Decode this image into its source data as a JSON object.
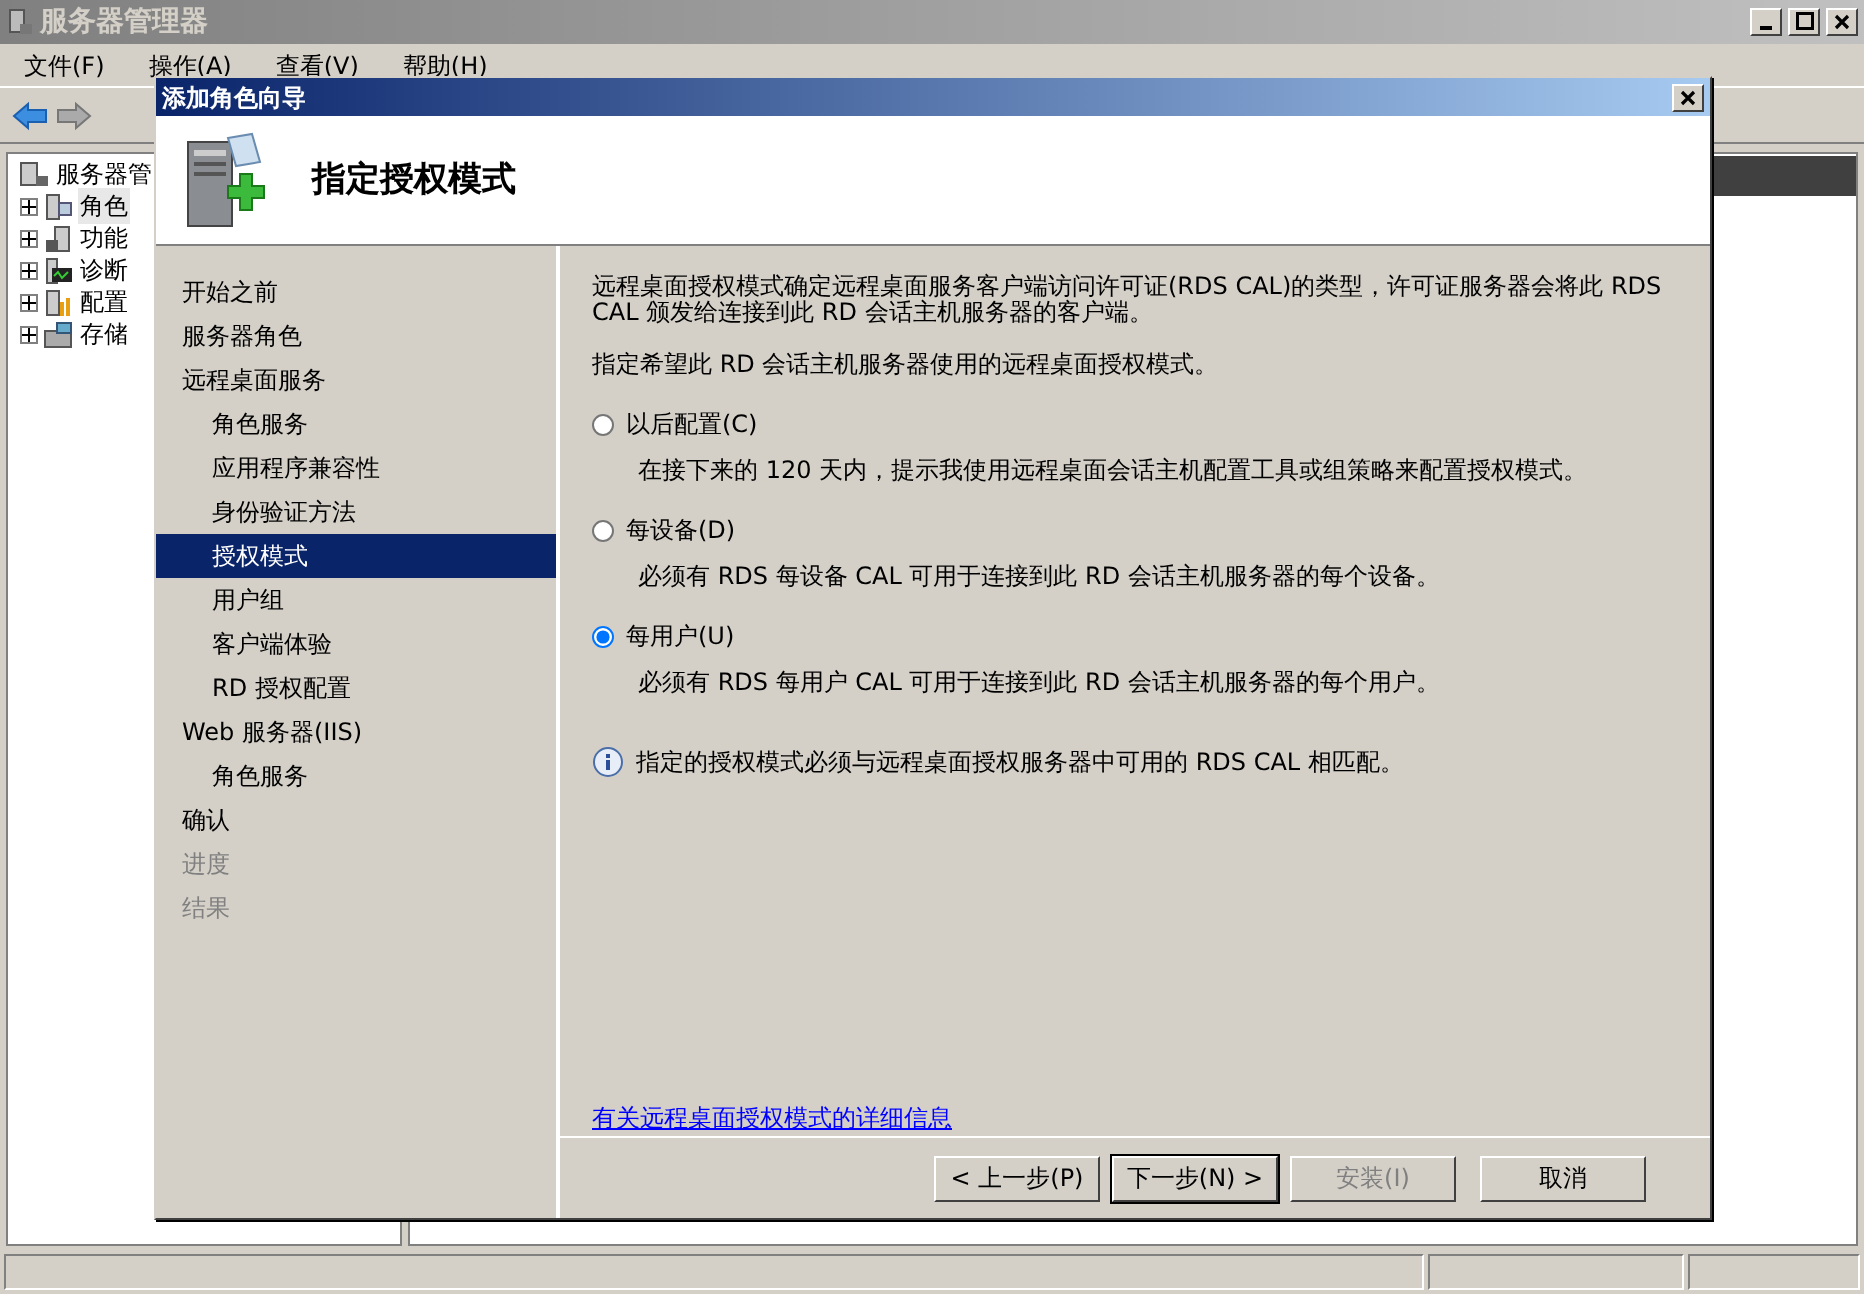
{
  "app": {
    "title": "服务器管理器",
    "menu": [
      "文件(F)",
      "操作(A)",
      "查看(V)",
      "帮助(H)"
    ],
    "tree": [
      {
        "label": "服务器管",
        "expanded": true,
        "children": [
          {
            "label": "角色",
            "selected": true,
            "expanded": false
          },
          {
            "label": "功能",
            "selected": false,
            "expanded": false
          },
          {
            "label": "诊断",
            "selected": false,
            "expanded": false
          },
          {
            "label": "配置",
            "selected": false,
            "expanded": false
          },
          {
            "label": "存储",
            "selected": false,
            "expanded": false
          }
        ]
      }
    ]
  },
  "dialog": {
    "title": "添加角色向导",
    "heading": "指定授权模式",
    "steps": [
      {
        "label": "开始之前",
        "selected": false,
        "disabled": false
      },
      {
        "label": "服务器角色",
        "selected": false,
        "disabled": false
      },
      {
        "label": "远程桌面服务",
        "selected": false,
        "disabled": false,
        "children": [
          {
            "label": "角色服务",
            "selected": false,
            "disabled": false
          },
          {
            "label": "应用程序兼容性",
            "selected": false,
            "disabled": false
          },
          {
            "label": "身份验证方法",
            "selected": false,
            "disabled": false
          },
          {
            "label": "授权模式",
            "selected": true,
            "disabled": false
          },
          {
            "label": "用户组",
            "selected": false,
            "disabled": false
          },
          {
            "label": "客户端体验",
            "selected": false,
            "disabled": false
          },
          {
            "label": "RD 授权配置",
            "selected": false,
            "disabled": false
          }
        ]
      },
      {
        "label": "Web 服务器(IIS)",
        "selected": false,
        "disabled": false,
        "children": [
          {
            "label": "角色服务",
            "selected": false,
            "disabled": false
          }
        ]
      },
      {
        "label": "确认",
        "selected": false,
        "disabled": false
      },
      {
        "label": "进度",
        "selected": false,
        "disabled": true
      },
      {
        "label": "结果",
        "selected": false,
        "disabled": true
      }
    ],
    "intro": "远程桌面授权模式确定远程桌面服务客户端访问许可证(RDS CAL)的类型，许可证服务器会将此 RDS CAL 颁发给连接到此 RD 会话主机服务器的客户端。",
    "prompt": "指定希望此 RD 会话主机服务器使用的远程桌面授权模式。",
    "options": [
      {
        "label": "以后配置(C)",
        "description": "在接下来的 120 天内，提示我使用远程桌面会话主机配置工具或组策略来配置授权模式。",
        "selected": false
      },
      {
        "label": "每设备(D)",
        "description": "必须有 RDS 每设备 CAL 可用于连接到此 RD 会话主机服务器的每个设备。",
        "selected": false
      },
      {
        "label": "每用户(U)",
        "description": "必须有 RDS 每用户 CAL 可用于连接到此 RD 会话主机服务器的每个用户。",
        "selected": true
      }
    ],
    "note": "指定的授权模式必须与远程桌面授权服务器中可用的 RDS CAL 相匹配。",
    "link": "有关远程桌面授权模式的详细信息",
    "buttons": [
      {
        "label": "< 上一步(P)",
        "disabled": false,
        "default": false
      },
      {
        "label": "下一步(N) >",
        "disabled": false,
        "default": true
      },
      {
        "label": "安装(I)",
        "disabled": true,
        "default": false
      },
      {
        "label": "取消",
        "disabled": false,
        "default": false
      }
    ]
  }
}
